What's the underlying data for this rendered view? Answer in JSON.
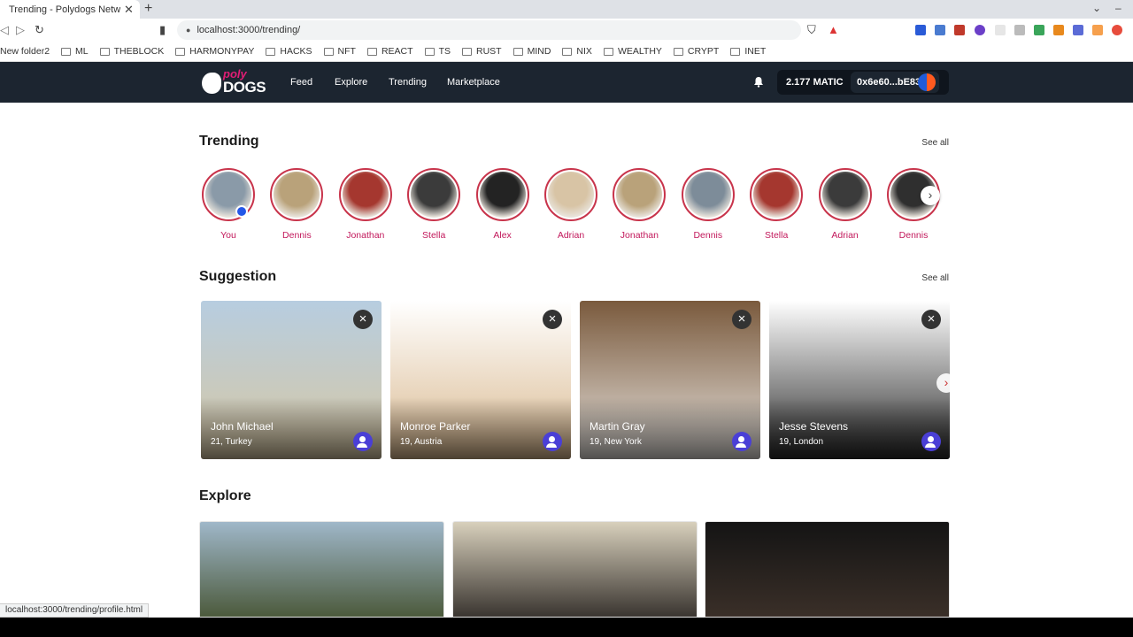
{
  "browser": {
    "tab_title": "Trending - Polydogs Netw",
    "tab_close": "✕",
    "new_tab": "+",
    "url": "localhost:3000/trending/",
    "status_url": "localhost:3000/trending/profile.html",
    "bookmarks": [
      "New folder2",
      "ML",
      "THEBLOCK",
      "HARMONYPAY",
      "HACKS",
      "NFT",
      "REACT",
      "TS",
      "RUST",
      "MIND",
      "NIX",
      "WEALTHY",
      "CRYPT",
      "INET"
    ]
  },
  "header": {
    "logo_top": "poly",
    "logo_bottom": "DOGS",
    "nav": [
      "Feed",
      "Explore",
      "Trending",
      "Marketplace"
    ],
    "balance": "2.177 MATIC",
    "address": "0x6e60...bE83"
  },
  "trending": {
    "title": "Trending",
    "see_all": "See all",
    "stories": [
      {
        "name": "You",
        "color": "#8a9aa8"
      },
      {
        "name": "Dennis",
        "color": "#b9a27a"
      },
      {
        "name": "Jonathan",
        "color": "#a5372f"
      },
      {
        "name": "Stella",
        "color": "#3b3b3b"
      },
      {
        "name": "Alex",
        "color": "#232323"
      },
      {
        "name": "Adrian",
        "color": "#d8c4a5"
      },
      {
        "name": "Jonathan",
        "color": "#b9a27a"
      },
      {
        "name": "Dennis",
        "color": "#7d8c99"
      },
      {
        "name": "Stella",
        "color": "#a5372f"
      },
      {
        "name": "Adrian",
        "color": "#3b3b3b"
      },
      {
        "name": "Dennis",
        "color": "#2f2f2f"
      }
    ]
  },
  "suggestion": {
    "title": "Suggestion",
    "see_all": "See all",
    "cards": [
      {
        "name": "John Michael",
        "meta": "21, Turkey",
        "top": "#b7cde0",
        "bottom": "#d7c7a3"
      },
      {
        "name": "Monroe Parker",
        "meta": "19, Austria",
        "top": "#ffffff",
        "bottom": "#d9b88e"
      },
      {
        "name": "Martin Gray",
        "meta": "19, New York",
        "top": "#7a5a3d",
        "bottom": "#e7e3de"
      },
      {
        "name": "Jesse Stevens",
        "meta": "19, London",
        "top": "#ffffff",
        "bottom": "#2a2a2a"
      }
    ]
  },
  "explore": {
    "title": "Explore",
    "tiles": [
      {
        "top": "#9fb7c9",
        "bottom": "#4c5a3c"
      },
      {
        "top": "#d8d0bc",
        "bottom": "#3a3530"
      },
      {
        "top": "#141414",
        "bottom": "#3a2f28"
      }
    ]
  }
}
